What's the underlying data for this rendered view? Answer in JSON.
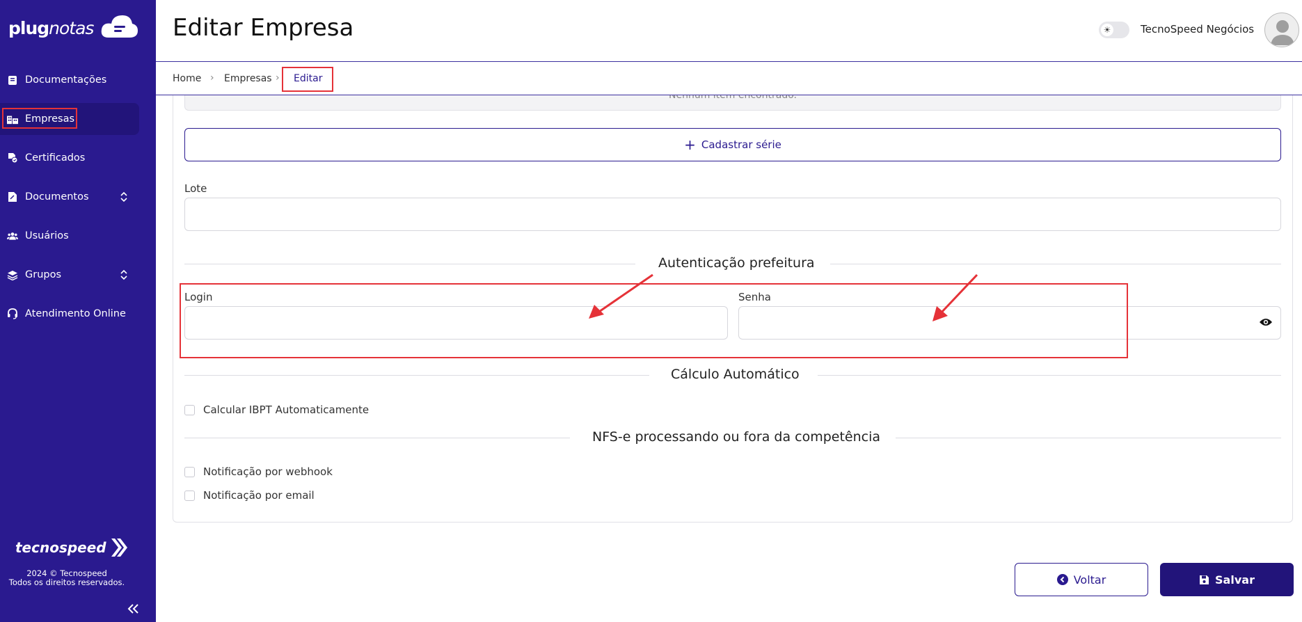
{
  "brand": {
    "logo_bold": "plug",
    "logo_italic": "notas"
  },
  "sidebar": {
    "items": [
      {
        "label": "Documentações",
        "icon": "book-icon"
      },
      {
        "label": "Empresas",
        "icon": "buildings-icon",
        "active": true
      },
      {
        "label": "Certificados",
        "icon": "certificate-icon"
      },
      {
        "label": "Documentos",
        "icon": "document-icon",
        "expandable": true
      },
      {
        "label": "Usuários",
        "icon": "users-icon"
      },
      {
        "label": "Grupos",
        "icon": "layers-icon",
        "expandable": true
      },
      {
        "label": "Atendimento Online",
        "icon": "headset-icon"
      }
    ],
    "footer_logo": "tecnospeed",
    "copyright_line1": "2024 © Tecnospeed",
    "copyright_line2": "Todos os direitos reservados."
  },
  "header": {
    "title": "Editar Empresa",
    "company": "TecnoSpeed Negócios"
  },
  "breadcrumb": {
    "items": [
      "Home",
      "Empresas",
      "Editar"
    ]
  },
  "form": {
    "empty_message": "Nenhum item encontrado.",
    "add_series_label": "Cadastrar série",
    "lote_label": "Lote",
    "lote_value": "",
    "auth_section": "Autenticação prefeitura",
    "login_label": "Login",
    "login_value": "",
    "password_label": "Senha",
    "password_value": "",
    "calc_section": "Cálculo Automático",
    "calc_ibpt_label": "Calcular IBPT Automaticamente",
    "nfse_section": "NFS-e processando ou fora da competência",
    "notify_webhook_label": "Notificação por webhook",
    "notify_email_label": "Notificação por email"
  },
  "actions": {
    "back_label": "Voltar",
    "save_label": "Salvar"
  },
  "colors": {
    "primary": "#2a1a8f",
    "primary_dark": "#22147a",
    "annotation": "#e53238"
  }
}
